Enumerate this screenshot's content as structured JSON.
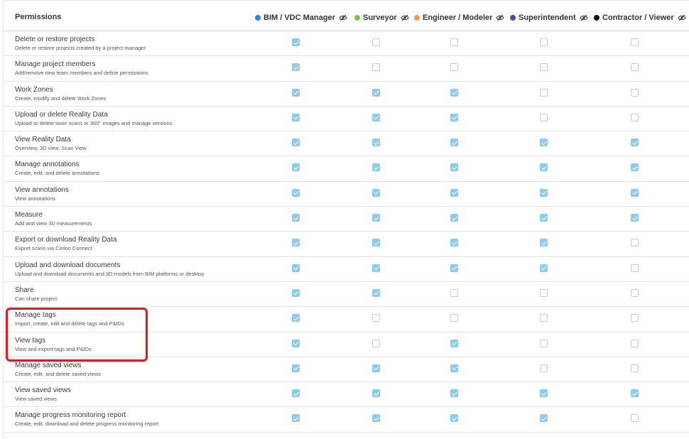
{
  "header": {
    "title": "Permissions",
    "roles": [
      {
        "name": "BIM / VDC Manager",
        "color": "#1a8fe3",
        "icon": "eye-slash-icon"
      },
      {
        "name": "Surveyor",
        "color": "#7cc54e",
        "icon": "eye-slash-icon"
      },
      {
        "name": "Engineer / Modeler",
        "color": "#f39a3c",
        "icon": "eye-slash-icon"
      },
      {
        "name": "Superintendent",
        "color": "#5b3fb0",
        "icon": "eye-slash-icon"
      },
      {
        "name": "Contractor / Viewer",
        "color": "#111111",
        "icon": "eye-slash-icon"
      }
    ]
  },
  "permissions": [
    {
      "label": "Delete or restore projects",
      "desc": "Delete or restore projects created by a project manager",
      "checks": [
        true,
        false,
        false,
        false,
        false
      ]
    },
    {
      "label": "Manage project members",
      "desc": "Add/remove new team members and define permissions",
      "checks": [
        true,
        false,
        false,
        false,
        false
      ]
    },
    {
      "label": "Work Zones",
      "desc": "Create, modify and delete Work Zones",
      "checks": [
        true,
        true,
        true,
        false,
        false
      ]
    },
    {
      "label": "Upload or delete Reality Data",
      "desc": "Upload or delete laser scans or 360° images and manage versions",
      "checks": [
        true,
        true,
        true,
        false,
        false
      ]
    },
    {
      "label": "View Reality Data",
      "desc": "Overview, 3D view, Scan View",
      "checks": [
        true,
        true,
        true,
        true,
        true
      ]
    },
    {
      "label": "Manage annotations",
      "desc": "Create, edit, and delete annotations",
      "checks": [
        true,
        true,
        true,
        true,
        true
      ]
    },
    {
      "label": "View annotations",
      "desc": "View annotations",
      "checks": [
        true,
        true,
        true,
        true,
        true
      ]
    },
    {
      "label": "Measure",
      "desc": "Add and view 3D measurements",
      "checks": [
        true,
        true,
        true,
        true,
        true
      ]
    },
    {
      "label": "Export or download Reality Data",
      "desc": "Export scans via Cintoo Connect",
      "checks": [
        true,
        true,
        true,
        true,
        false
      ]
    },
    {
      "label": "Upload and download documents",
      "desc": "Upload and download documents and 3D models from BIM platforms or desktop",
      "checks": [
        true,
        true,
        true,
        true,
        false
      ]
    },
    {
      "label": "Share",
      "desc": "Can share project",
      "checks": [
        true,
        true,
        false,
        false,
        false
      ]
    },
    {
      "label": "Manage tags",
      "desc": "Import, create, edit and delete tags and P&IDs",
      "checks": [
        true,
        false,
        false,
        false,
        false
      ]
    },
    {
      "label": "View tags",
      "desc": "View and export tags and P&IDs",
      "checks": [
        true,
        false,
        true,
        false,
        false
      ]
    },
    {
      "label": "Manage saved views",
      "desc": "Create, edit, and delete saved views",
      "checks": [
        true,
        true,
        true,
        false,
        false
      ]
    },
    {
      "label": "View saved views",
      "desc": "View saved views",
      "checks": [
        true,
        true,
        true,
        true,
        true
      ]
    },
    {
      "label": "Manage progress monitoring report",
      "desc": "Create, edit, download and delete progress monitoring report",
      "checks": [
        true,
        true,
        true,
        true,
        false
      ]
    }
  ]
}
